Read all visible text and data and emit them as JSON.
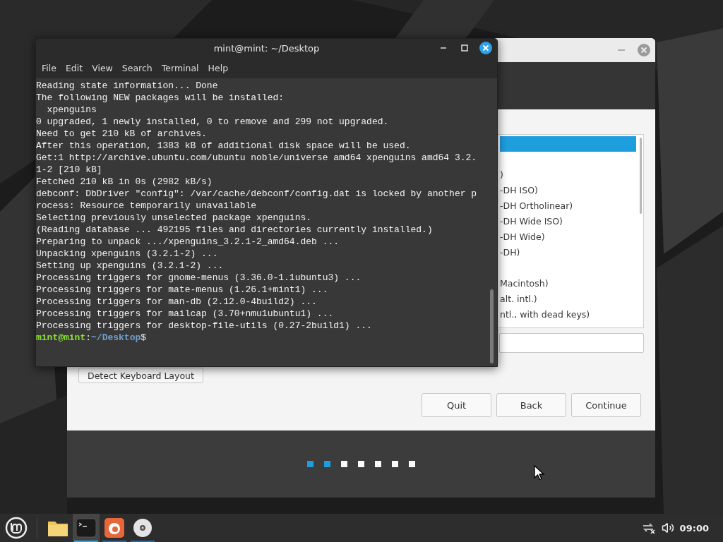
{
  "installer": {
    "list_rows": [
      {
        "selected": true
      },
      {
        "selected": false
      },
      {
        "text": ")",
        "selected": false
      },
      {
        "text": "-DH ISO)",
        "selected": false
      },
      {
        "text": "-DH Ortholinear)",
        "selected": false
      },
      {
        "text": "-DH Wide ISO)",
        "selected": false
      },
      {
        "text": "-DH Wide)",
        "selected": false
      },
      {
        "text": "-DH)",
        "selected": false
      },
      {
        "selected": false
      },
      {
        "text": "Macintosh)",
        "selected": false
      },
      {
        "text": "alt. intl.)",
        "selected": false
      },
      {
        "text": "ntl., with dead keys)",
        "selected": false
      }
    ],
    "detect_button": "Detect Keyboard Layout",
    "buttons": [
      "Quit",
      "Back",
      "Continue"
    ],
    "steps": [
      {
        "active": true
      },
      {
        "active": true
      },
      {
        "active": false
      },
      {
        "active": false
      },
      {
        "active": false
      },
      {
        "active": false
      },
      {
        "active": false
      }
    ]
  },
  "terminal": {
    "title": "mint@mint: ~/Desktop",
    "menu": [
      "File",
      "Edit",
      "View",
      "Search",
      "Terminal",
      "Help"
    ],
    "lines": [
      "Reading state information... Done",
      "The following NEW packages will be installed:",
      "  xpenguins",
      "0 upgraded, 1 newly installed, 0 to remove and 299 not upgraded.",
      "Need to get 210 kB of archives.",
      "After this operation, 1383 kB of additional disk space will be used.",
      "Get:1 http://archive.ubuntu.com/ubuntu noble/universe amd64 xpenguins amd64 3.2.",
      "1-2 [210 kB]",
      "Fetched 210 kB in 0s (2982 kB/s)",
      "debconf: DbDriver \"config\": /var/cache/debconf/config.dat is locked by another p",
      "rocess: Resource temporarily unavailable",
      "Selecting previously unselected package xpenguins.",
      "(Reading database ... 492195 files and directories currently installed.)",
      "Preparing to unpack .../xpenguins_3.2.1-2_amd64.deb ...",
      "Unpacking xpenguins (3.2.1-2) ...",
      "Setting up xpenguins (3.2.1-2) ...",
      "Processing triggers for gnome-menus (3.36.0-1.1ubuntu3) ...",
      "Processing triggers for mate-menus (1.26.1+mint1) ...",
      "Processing triggers for man-db (2.12.0-4build2) ...",
      "Processing triggers for mailcap (3.70+nmu1ubuntu1) ...",
      "Processing triggers for desktop-file-utils (0.27-2build1) ..."
    ],
    "prompt": {
      "user": "mint@mint",
      "sep": ":",
      "path": "~/Desktop",
      "symbol": "$"
    }
  },
  "taskbar": {
    "apps": [
      {
        "kind": "menu",
        "running": false,
        "focused": false
      },
      {
        "kind": "folder",
        "running": false,
        "focused": false
      },
      {
        "kind": "terminal",
        "running": true,
        "focused": true
      },
      {
        "kind": "firefox",
        "running": true,
        "focused": false
      },
      {
        "kind": "disc",
        "running": true,
        "focused": false
      }
    ],
    "clock": "09:00"
  }
}
